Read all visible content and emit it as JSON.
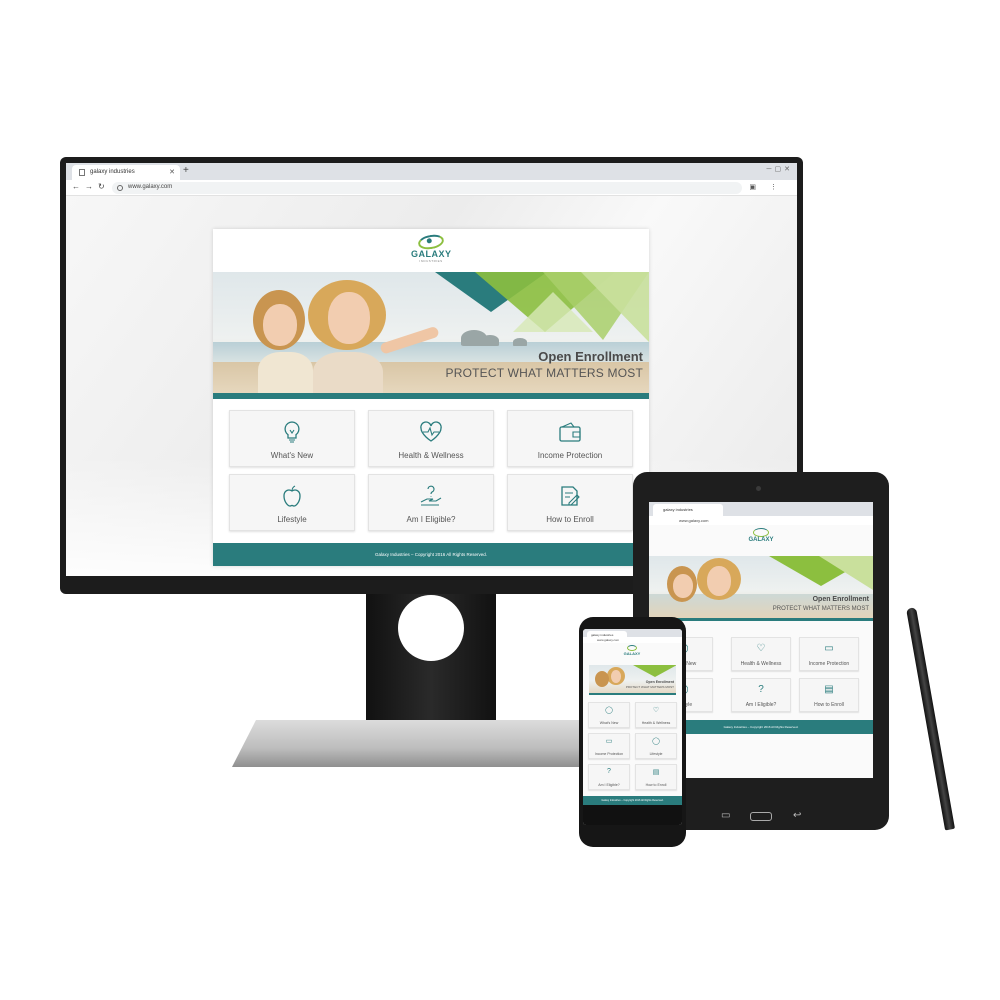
{
  "browser": {
    "tab_title": "galaxy industries",
    "url": "www.galaxy.com"
  },
  "site": {
    "logo_text": "GALAXY",
    "logo_subtext": "INDUSTRIES",
    "hero_title": "Open Enrollment",
    "hero_subtitle": "PROTECT WHAT MATTERS MOST",
    "tiles": [
      {
        "label": "What's New",
        "icon": "lightbulb-icon"
      },
      {
        "label": "Health & Wellness",
        "icon": "heart-pulse-icon"
      },
      {
        "label": "Income Protection",
        "icon": "wallet-icon"
      },
      {
        "label": "Lifestyle",
        "icon": "apple-icon"
      },
      {
        "label": "Am I Eligible?",
        "icon": "hand-question-icon"
      },
      {
        "label": "How to Enroll",
        "icon": "document-pencil-icon"
      }
    ],
    "footer": "Galaxy Industries – Copyright 2016 All Rights Reserved."
  },
  "colors": {
    "brand_teal": "#2a7c7d",
    "brand_green": "#8cbf3f"
  }
}
